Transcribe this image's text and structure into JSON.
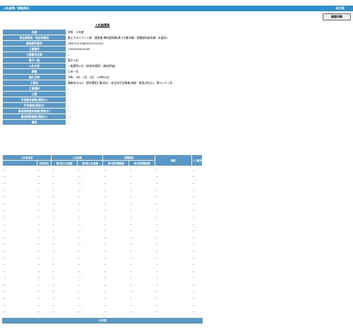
{
  "header": {
    "title": "入札結果／詳細表示",
    "right_label": "本文表"
  },
  "print_button": "画面印刷",
  "page_title": "入札結果表",
  "fields": [
    {
      "label": "年度",
      "value": "令和　４年度"
    },
    {
      "label": "発注部局名／発注所属名",
      "value": "県土マネジメント部　建設業 降府留境課(県マネ都本課／首農部局部本課／水道局)"
    },
    {
      "label": "調達案件番号",
      "value": "280010130800202203241"
    },
    {
      "label": "工事番号",
      "value": "1305255040169"
    },
    {
      "label": "工事番号名称",
      "value": "--"
    },
    {
      "label": "電子／紙",
      "value": "電子入札"
    },
    {
      "label": "入札方式",
      "value": "一般競争入札［参加申請型］(総合評価)"
    },
    {
      "label": "業種",
      "value": "土木一式"
    },
    {
      "label": "開札日時",
      "value": "令和　5年　2月　8日　10時30分"
    },
    {
      "label": "工事名",
      "value": "青森市川(公)　防防環境工事(防災・安全交付金事業(海部・東部)(防災))　第51～5-1号"
    },
    {
      "label": "工事場所",
      "value": "--"
    },
    {
      "label": "工期",
      "value": "--"
    },
    {
      "label": "予定基本価格(税抜き)",
      "value": "--"
    },
    {
      "label": "予定価格(税抜き)",
      "value": "--"
    },
    {
      "label": "最低制限基本価格(税抜き)",
      "value": "--"
    },
    {
      "label": "最低制限価格(税抜き)",
      "value": "--"
    },
    {
      "label": "備考",
      "value": "--"
    }
  ],
  "bid_table": {
    "group_headers": [
      "入札参加者",
      "入札結果",
      "見積結果",
      "摘要",
      "くじ番号"
    ],
    "sub_headers": [
      "代表者名",
      "第1回入札金額",
      "第2回入札金額",
      "第1回見積金額",
      "第2回見積金額"
    ],
    "rows": [
      [
        "--",
        "--",
        "--",
        "--",
        "--",
        "--",
        "--",
        "--"
      ],
      [
        "--",
        "--",
        "--",
        "--",
        "--",
        "--",
        "--",
        "--"
      ],
      [
        "--",
        "--",
        "--",
        "--",
        "--",
        "--",
        "--",
        "--"
      ],
      [
        "--",
        "--",
        "--",
        "--",
        "--",
        "--",
        "--",
        "--"
      ],
      [
        "--",
        "--",
        "--",
        "--",
        "--",
        "--",
        "--",
        "--"
      ],
      [
        "--",
        "--",
        "--",
        "--",
        "--",
        "--",
        "--",
        "--"
      ],
      [
        "--",
        "--",
        "--",
        "--",
        "--",
        "--",
        "--",
        "--"
      ],
      [
        "--",
        "--",
        "--",
        "--",
        "--",
        "--",
        "--",
        "--"
      ],
      [
        "--",
        "--",
        "--",
        "--",
        "--",
        "--",
        "--",
        "--"
      ],
      [
        "--",
        "--",
        "--",
        "--",
        "--",
        "--",
        "--",
        "--"
      ],
      [
        "--",
        "--",
        "--",
        "--",
        "--",
        "--",
        "--",
        "--"
      ],
      [
        "--",
        "--",
        "--",
        "--",
        "--",
        "--",
        "--",
        "--"
      ],
      [
        "--",
        "--",
        "--",
        "--",
        "--",
        "--",
        "--",
        "--"
      ],
      [
        "--",
        "--",
        "--",
        "--",
        "--",
        "--",
        "--",
        "--"
      ],
      [
        "--",
        "--",
        "--",
        "--",
        "--",
        "--",
        "--",
        "--"
      ],
      [
        "--",
        "--",
        "--",
        "--",
        "--",
        "--",
        "--",
        "--"
      ],
      [
        "--",
        "--",
        "--",
        "--",
        "--",
        "--",
        "--",
        "--"
      ],
      [
        "--",
        "--",
        "--",
        "--",
        "--",
        "--",
        "--",
        "--"
      ],
      [
        "--",
        "--",
        "--",
        "--",
        "--",
        "--",
        "--",
        "--"
      ],
      [
        "--",
        "--",
        "--",
        "--",
        "--",
        "--",
        "--",
        "--"
      ],
      [
        "--",
        "--",
        "--",
        "--",
        "--",
        "--",
        "--",
        "--"
      ],
      [
        "--",
        "--",
        "--",
        "--",
        "--",
        "--",
        "--",
        "--"
      ]
    ]
  },
  "other_section": "その他",
  "colors": {
    "header_bar": "#2f8fc8",
    "label_cell": "#5a98c8"
  }
}
